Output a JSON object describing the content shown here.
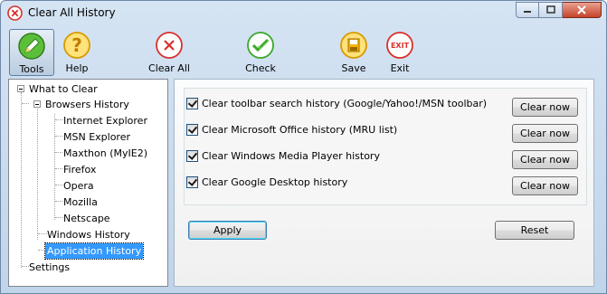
{
  "window": {
    "title": "Clear All History"
  },
  "toolbar": {
    "items": [
      {
        "label": "Tools",
        "icon": "pencil-icon",
        "selected": true
      },
      {
        "label": "Help",
        "icon": "help-icon",
        "selected": false
      },
      {
        "label": "Clear All",
        "icon": "clear-all-icon",
        "selected": false
      },
      {
        "label": "Check",
        "icon": "check-icon",
        "selected": false
      },
      {
        "label": "Save",
        "icon": "save-icon",
        "selected": false
      },
      {
        "label": "Exit",
        "icon": "exit-icon",
        "selected": false
      }
    ],
    "exit_badge": "EXIT"
  },
  "tree": {
    "what_to_clear": "What to Clear",
    "browsers_history": "Browsers History",
    "browsers": [
      "Internet Explorer",
      "MSN Explorer",
      "Maxthon (MyIE2)",
      "Firefox",
      "Opera",
      "Mozilla",
      "Netscape"
    ],
    "windows_history": "Windows History",
    "application_history": "Application History",
    "settings": "Settings",
    "selected": "Application History"
  },
  "options": [
    {
      "label": "Clear toolbar search history (Google/Yahoo!/MSN toolbar)",
      "checked": true,
      "button": "Clear now"
    },
    {
      "label": "Clear Microsoft Office history (MRU list)",
      "checked": true,
      "button": "Clear now"
    },
    {
      "label": "Clear Windows Media Player history",
      "checked": true,
      "button": "Clear now"
    },
    {
      "label": "Clear Google Desktop history",
      "checked": true,
      "button": "Clear now"
    }
  ],
  "actions": {
    "apply": "Apply",
    "reset": "Reset"
  },
  "colors": {
    "selection": "#3399ff",
    "close_button": "#c7432a"
  }
}
